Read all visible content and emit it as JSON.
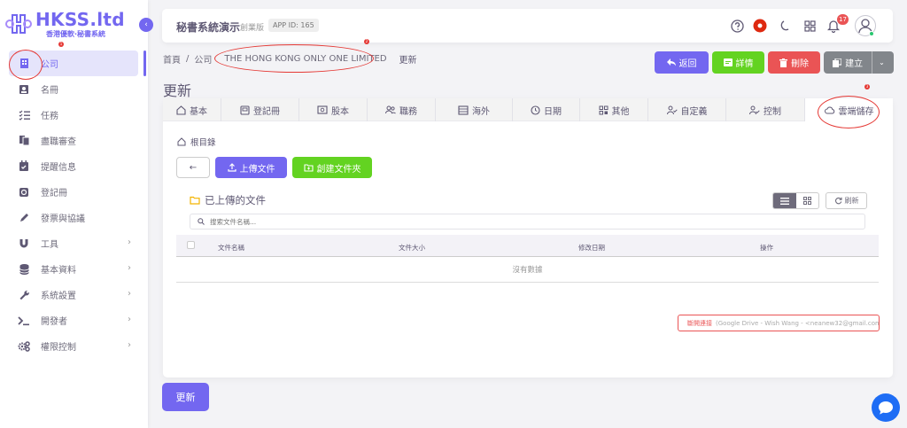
{
  "brand": {
    "title": "HKSS.ltd",
    "subtitle": "香港優軟·秘書系統"
  },
  "sidebar": {
    "items": [
      {
        "label": "公司",
        "icon": "building-icon",
        "active": true
      },
      {
        "label": "名冊",
        "icon": "contacts-icon"
      },
      {
        "label": "任務",
        "icon": "task-list-icon"
      },
      {
        "label": "盡職審查",
        "icon": "documents-icon"
      },
      {
        "label": "提醒信息",
        "icon": "calendar-check-icon"
      },
      {
        "label": "登記冊",
        "icon": "register-icon"
      },
      {
        "label": "發票與協議",
        "icon": "pen-icon"
      },
      {
        "label": "工具",
        "icon": "magnet-icon",
        "expandable": true
      },
      {
        "label": "基本資料",
        "icon": "database-icon",
        "expandable": true
      },
      {
        "label": "系統設置",
        "icon": "wrench-icon",
        "expandable": true
      },
      {
        "label": "開發者",
        "icon": "terminal-icon",
        "expandable": true
      },
      {
        "label": "權限控制",
        "icon": "cogs-icon",
        "expandable": true
      }
    ]
  },
  "topbar": {
    "app_title": "秘書系統演示",
    "edition": "創業版",
    "app_id": "APP ID: 165",
    "notification_count": "17"
  },
  "breadcrumb": {
    "home": "首頁",
    "separator": "/",
    "company": "公司",
    "entity": "THE HONG KONG ONLY ONE LIMITED",
    "current": "更新"
  },
  "actions": {
    "back": "返回",
    "details": "詳情",
    "delete": "刪除",
    "create": "建立"
  },
  "page": {
    "title": "更新"
  },
  "tabs": [
    {
      "label": "基本",
      "icon": "home-icon"
    },
    {
      "label": "登記冊",
      "icon": "book-icon"
    },
    {
      "label": "股本",
      "icon": "money-icon"
    },
    {
      "label": "職務",
      "icon": "users-icon"
    },
    {
      "label": "海外",
      "icon": "globe-icon"
    },
    {
      "label": "日期",
      "icon": "clock-icon"
    },
    {
      "label": "其他",
      "icon": "grid-icon"
    },
    {
      "label": "自定義",
      "icon": "user-check-icon"
    },
    {
      "label": "控制",
      "icon": "user-cog-icon"
    },
    {
      "label": "雲端儲存",
      "icon": "cloud-icon",
      "active": true
    }
  ],
  "storage": {
    "root_label": "根目錄",
    "back_button": "←",
    "upload": "上傳文件",
    "new_folder": "創建文件夾",
    "uploaded_title": "已上傳的文件",
    "refresh": "刷新",
    "search_placeholder": "搜索文件名稱...",
    "columns": [
      "文件名稱",
      "文件大小",
      "修改日期",
      "操作"
    ],
    "empty": "沒有數據",
    "disconnect_label": "斷開連接",
    "account": "(Google Drive - Wish Wang - <neanew32@gmail.com>)"
  },
  "footer": {
    "update_button": "更新"
  },
  "annotations": [
    "1",
    "2",
    "3"
  ],
  "colors": {
    "primary": "#7367f0",
    "success": "#63d321",
    "danger": "#ea5455",
    "secondary": "#82868b",
    "annotation": "#e53935"
  }
}
